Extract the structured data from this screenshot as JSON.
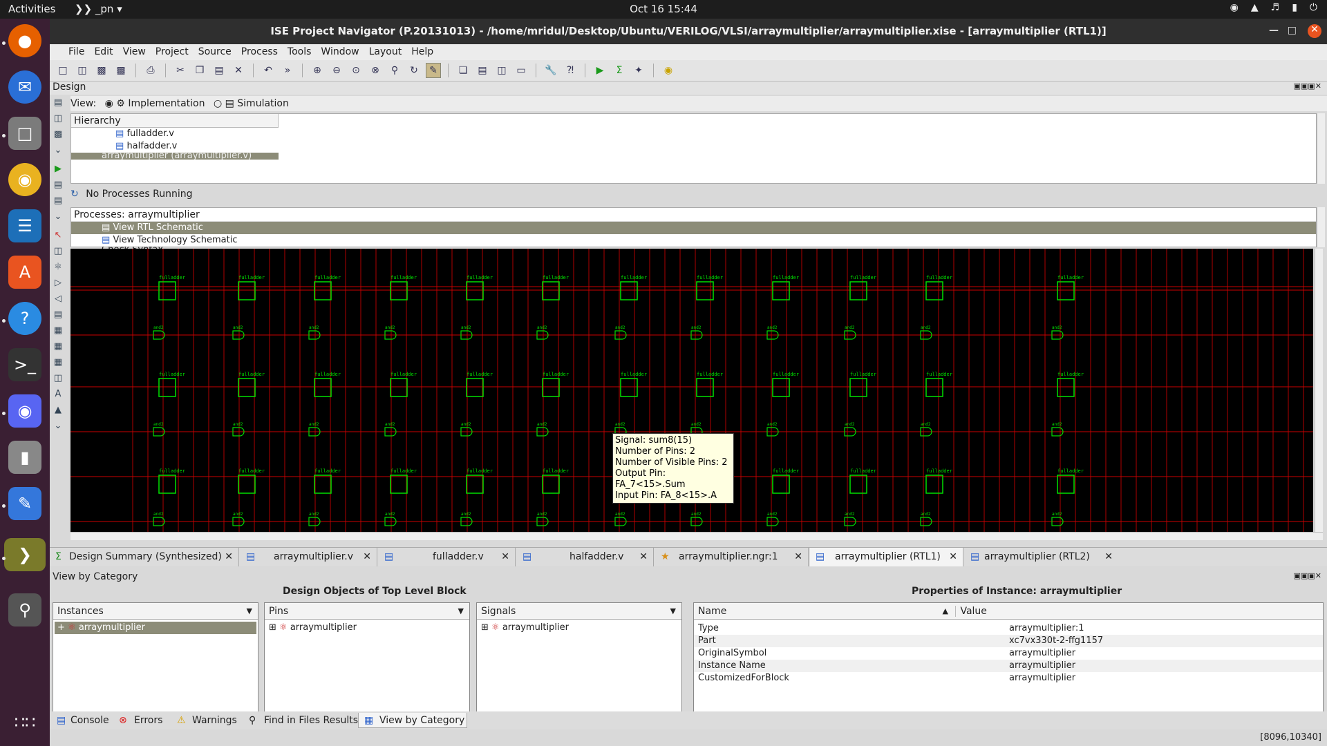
{
  "topbar": {
    "activities": "Activities",
    "app_name": "_pn",
    "clock": "Oct 16  15:44"
  },
  "window": {
    "title": "ISE Project Navigator (P.20131013) - /home/mridul/Desktop/Ubuntu/VERILOG/VLSI/arraymultiplier/arraymultiplier.xise - [arraymultiplier (RTL1)]"
  },
  "menu": [
    "File",
    "Edit",
    "View",
    "Project",
    "Source",
    "Process",
    "Tools",
    "Window",
    "Layout",
    "Help"
  ],
  "design": {
    "label": "Design",
    "view_label": "View:",
    "impl": "Implementation",
    "sim": "Simulation",
    "hierarchy_header": "Hierarchy",
    "hierarchy_items": [
      "fulladder.v",
      "halfadder.v",
      "arraymultiplier (arraymultiplier.v)"
    ],
    "process_status": "No Processes Running",
    "processes_header": "Processes: arraymultiplier",
    "processes": [
      "View RTL Schematic",
      "View Technology Schematic",
      "Check Syntax"
    ]
  },
  "schematic": {
    "fulladder_label": "fulladder",
    "and_label": "and2",
    "tooltip": [
      "Signal: sum8(15)",
      "Number of Pins: 2",
      "Number of Visible Pins: 2",
      "Output Pin: FA_7<15>.Sum",
      "Input Pin: FA_8<15>.A"
    ]
  },
  "tabs": [
    {
      "label": "Design Summary (Synthesized)",
      "icon": "sigma-icon"
    },
    {
      "label": "arraymultiplier.v",
      "icon": "document-icon"
    },
    {
      "label": "fulladder.v",
      "icon": "document-icon"
    },
    {
      "label": "halfadder.v",
      "icon": "document-icon"
    },
    {
      "label": "arraymultiplier.ngr:1",
      "icon": "ngr-icon"
    },
    {
      "label": "arraymultiplier (RTL1)",
      "icon": "schematic-icon"
    },
    {
      "label": "arraymultiplier (RTL2)",
      "icon": "schematic-icon"
    }
  ],
  "view_by_category": {
    "label": "View by Category",
    "design_objects_title": "Design Objects of Top Level Block",
    "properties_title": "Properties of Instance: arraymultiplier",
    "instances": {
      "header": "Instances",
      "item": "arraymultiplier"
    },
    "pins": {
      "header": "Pins",
      "item": "arraymultiplier"
    },
    "signals": {
      "header": "Signals",
      "item": "arraymultiplier"
    },
    "properties": {
      "name_header": "Name",
      "value_header": "Value",
      "rows": [
        {
          "name": "Type",
          "value": "arraymultiplier:1"
        },
        {
          "name": "Part",
          "value": "xc7vx330t-2-ffg1157"
        },
        {
          "name": "OriginalSymbol",
          "value": "arraymultiplier"
        },
        {
          "name": "Instance Name",
          "value": "arraymultiplier"
        },
        {
          "name": "CustomizedForBlock",
          "value": "arraymultiplier"
        }
      ]
    }
  },
  "bottom_tabs": [
    "Console",
    "Errors",
    "Warnings",
    "Find in Files Results",
    "View by Category"
  ],
  "status": {
    "coords": "[8096,10340]"
  }
}
